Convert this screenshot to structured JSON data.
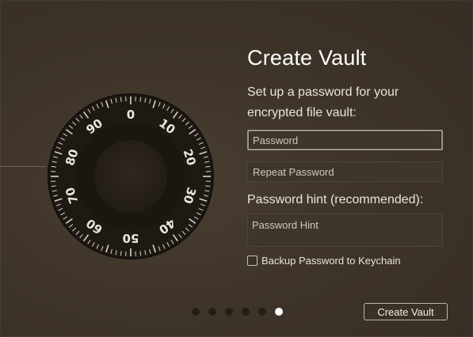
{
  "title": "Create Vault",
  "subtitle": "Set up a password for your encrypted file vault:",
  "password": {
    "placeholder": "Password",
    "value": ""
  },
  "repeat_password": {
    "placeholder": "Repeat Password",
    "value": ""
  },
  "hint": {
    "label": "Password hint (recommended):",
    "placeholder": "Password Hint"
  },
  "checkbox": {
    "label": "Backup Password to Keychain",
    "checked": false
  },
  "pager": {
    "total": 6,
    "current": 6
  },
  "create_button": "Create Vault",
  "dial": {
    "numbers": [
      "0",
      "10",
      "20",
      "30",
      "40",
      "50",
      "60",
      "70",
      "80",
      "90"
    ]
  },
  "colors": {
    "accent": "#ffffff",
    "background": "#3e3429",
    "dial_ring": "#1f1914"
  }
}
